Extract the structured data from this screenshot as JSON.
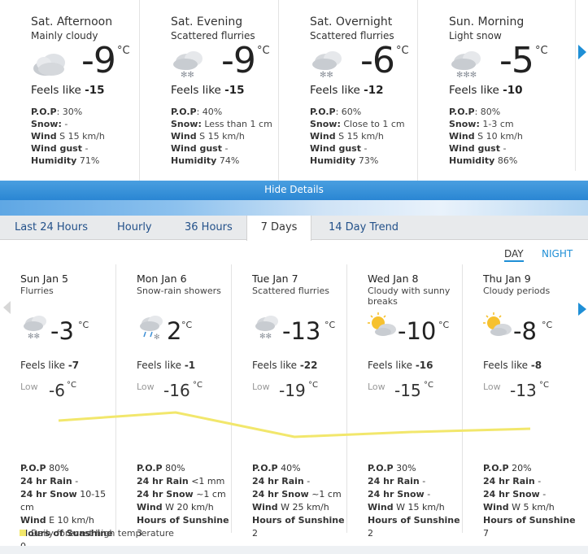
{
  "periods": [
    {
      "title": "Sat. Afternoon",
      "condition": "Mainly cloudy",
      "temp": "-9",
      "unit": "°C",
      "feels_label": "Feels like",
      "feels": "-15",
      "pop_label": "P.O.P",
      "pop": "30%",
      "snow_label": "Snow:",
      "snow": "-",
      "wind_label": "Wind",
      "wind": "S 15 km/h",
      "gust_label": "Wind gust",
      "gust": "-",
      "humidity_label": "Humidity",
      "humidity": "71%",
      "icon": "mainly-cloudy-icon"
    },
    {
      "title": "Sat. Evening",
      "condition": "Scattered flurries",
      "temp": "-9",
      "unit": "°C",
      "feels_label": "Feels like",
      "feels": "-15",
      "pop_label": "P.O.P",
      "pop": "40%",
      "snow_label": "Snow:",
      "snow": "Less than 1 cm",
      "wind_label": "Wind",
      "wind": "S 15 km/h",
      "gust_label": "Wind gust",
      "gust": "-",
      "humidity_label": "Humidity",
      "humidity": "74%",
      "icon": "flurries-icon"
    },
    {
      "title": "Sat. Overnight",
      "condition": "Scattered flurries",
      "temp": "-6",
      "unit": "°C",
      "feels_label": "Feels like",
      "feels": "-12",
      "pop_label": "P.O.P",
      "pop": "60%",
      "snow_label": "Snow:",
      "snow": "Close to 1 cm",
      "wind_label": "Wind",
      "wind": "S 15 km/h",
      "gust_label": "Wind gust",
      "gust": "-",
      "humidity_label": "Humidity",
      "humidity": "73%",
      "icon": "flurries-icon"
    },
    {
      "title": "Sun. Morning",
      "condition": "Light snow",
      "temp": "-5",
      "unit": "°C",
      "feels_label": "Feels like",
      "feels": "-10",
      "pop_label": "P.O.P",
      "pop": "80%",
      "snow_label": "Snow:",
      "snow": "1-3 cm",
      "wind_label": "Wind",
      "wind": "S 10 km/h",
      "gust_label": "Wind gust",
      "gust": "-",
      "humidity_label": "Humidity",
      "humidity": "86%",
      "icon": "light-snow-icon"
    }
  ],
  "hide_details": "Hide Details",
  "tabs": [
    {
      "label": "Last 24 Hours"
    },
    {
      "label": "Hourly"
    },
    {
      "label": "36 Hours"
    },
    {
      "label": "7 Days"
    },
    {
      "label": "14 Day Trend"
    }
  ],
  "active_tab": "7 Days",
  "day_toggle": "DAY",
  "night_toggle": "NIGHT",
  "days": [
    {
      "date": "Sun Jan 5",
      "condition": "Flurries",
      "high": "-3",
      "unit": "°C",
      "feels_label": "Feels like",
      "feels": "-7",
      "low_label": "Low",
      "low": "-6",
      "pop_label": "P.O.P",
      "pop": "80%",
      "rain_label": "24 hr Rain",
      "rain": "-",
      "snow_label": "24 hr Snow",
      "snow": "10-15 cm",
      "wind_label": "Wind",
      "wind": "E 10 km/h",
      "sun_label": "Hours of Sunshine",
      "sun": "0",
      "icon": "flurries-icon"
    },
    {
      "date": "Mon Jan 6",
      "condition": "Snow-rain showers",
      "high": "2",
      "unit": "°C",
      "feels_label": "Feels like",
      "feels": "-1",
      "low_label": "Low",
      "low": "-16",
      "pop_label": "P.O.P",
      "pop": "80%",
      "rain_label": "24 hr Rain",
      "rain": "<1 mm",
      "snow_label": "24 hr Snow",
      "snow": "~1 cm",
      "wind_label": "Wind",
      "wind": "W 20 km/h",
      "sun_label": "Hours of Sunshine",
      "sun": "3",
      "icon": "snow-rain-icon"
    },
    {
      "date": "Tue Jan 7",
      "condition": "Scattered flurries",
      "high": "-13",
      "unit": "°C",
      "feels_label": "Feels like",
      "feels": "-22",
      "low_label": "Low",
      "low": "-19",
      "pop_label": "P.O.P",
      "pop": "40%",
      "rain_label": "24 hr Rain",
      "rain": "-",
      "snow_label": "24 hr Snow",
      "snow": "~1 cm",
      "wind_label": "Wind",
      "wind": "W 25 km/h",
      "sun_label": "Hours of Sunshine",
      "sun": "2",
      "icon": "flurries-icon"
    },
    {
      "date": "Wed Jan 8",
      "condition": "Cloudy with sunny breaks",
      "high": "-10",
      "unit": "°C",
      "feels_label": "Feels like",
      "feels": "-16",
      "low_label": "Low",
      "low": "-15",
      "pop_label": "P.O.P",
      "pop": "30%",
      "rain_label": "24 hr Rain",
      "rain": "-",
      "snow_label": "24 hr Snow",
      "snow": "-",
      "wind_label": "Wind",
      "wind": "W 15 km/h",
      "sun_label": "Hours of Sunshine",
      "sun": "2",
      "icon": "sun-cloud-icon"
    },
    {
      "date": "Thu Jan 9",
      "condition": "Cloudy periods",
      "high": "-8",
      "unit": "°C",
      "feels_label": "Feels like",
      "feels": "-8",
      "low_label": "Low",
      "low": "-13",
      "pop_label": "P.O.P",
      "pop": "20%",
      "rain_label": "24 hr Rain",
      "rain": "-",
      "snow_label": "24 hr Snow",
      "snow": "-",
      "wind_label": "Wind",
      "wind": "W 5 km/h",
      "sun_label": "Hours of Sunshine",
      "sun": "7",
      "icon": "sun-cloud-icon"
    }
  ],
  "legend": "Daily forecast high temperature",
  "colors": {
    "accent": "#1f8fd6",
    "trend_line": "#f2e76c",
    "tab_bar": "#e8eaec"
  }
}
